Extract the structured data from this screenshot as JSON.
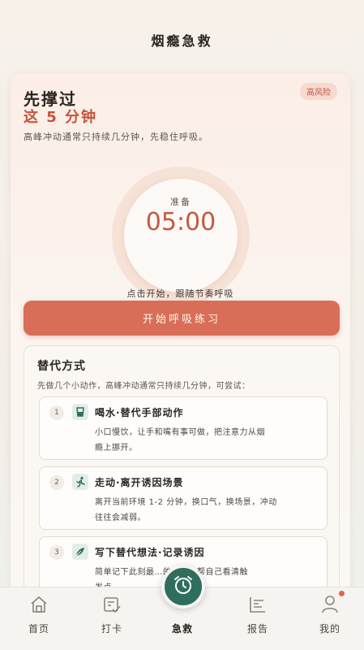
{
  "header": {
    "title": "烟瘾急救"
  },
  "hero": {
    "badge": "高风险",
    "headline_line1": "先撑过",
    "headline_line2": "这 5 分钟",
    "subtitle": "高峰冲动通常只持续几分钟，先稳住呼吸。"
  },
  "timer": {
    "label": "准备",
    "value": "05:00"
  },
  "hint": "点击开始，跟随节奏呼吸",
  "start_button": "开始呼吸练习",
  "alternatives": {
    "title": "替代方式",
    "subtitle": "先做几个小动作，高峰冲动通常只持续几分钟，可尝试：",
    "items": [
      {
        "num": "1",
        "icon": "cup-icon",
        "title": "喝水·替代手部动作",
        "desc_line1": "小口慢饮，让手和嘴有事可做，把注意力从烟",
        "desc_line2": "瘾上挪开。"
      },
      {
        "num": "2",
        "icon": "running-person-icon",
        "title": "走动·离开诱因场景",
        "desc_line1": "离开当前环境 1-2 分钟，换口气，换场景，冲动",
        "desc_line2": "往往会减弱。"
      },
      {
        "num": "3",
        "icon": "leaf-pen-icon",
        "title": "写下替代想法·记录诱因",
        "desc_line1": "简单记下此刻最…的原因，帮自己看清触",
        "desc_line2": "发点…"
      }
    ]
  },
  "tabbar": {
    "items": [
      {
        "label": "首页",
        "icon": "home-icon"
      },
      {
        "label": "打卡",
        "icon": "checkin-icon"
      },
      {
        "label": "急救",
        "icon": "alarm-clock-icon"
      },
      {
        "label": "报告",
        "icon": "report-chart-icon"
      },
      {
        "label": "我的",
        "icon": "profile-icon"
      }
    ]
  },
  "colors": {
    "accent": "#d86e57",
    "brand_green": "#2f6e5e",
    "danger_text": "#c4543a"
  }
}
